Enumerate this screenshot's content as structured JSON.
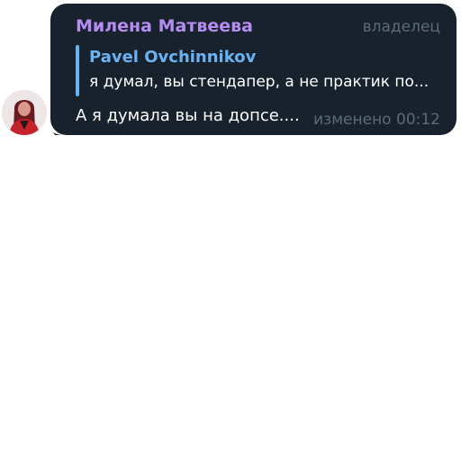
{
  "message": {
    "sender_name": "Милена Матвеева",
    "sender_role": "владелец",
    "reply": {
      "author": "Pavel Ovchinnikov",
      "text": "я думал, вы стендапер, а не практик по..."
    },
    "text": "А я думала вы на допсе....",
    "edited_label": "изменено",
    "time": "00:12"
  },
  "colors": {
    "bubble_bg": "#18222d",
    "sender_name": "#b58cf1",
    "reply_accent": "#6ab3f3",
    "meta_text": "#5c6a79",
    "message_text": "#ffffff"
  },
  "icons": {
    "avatar": "user-avatar-photo"
  }
}
